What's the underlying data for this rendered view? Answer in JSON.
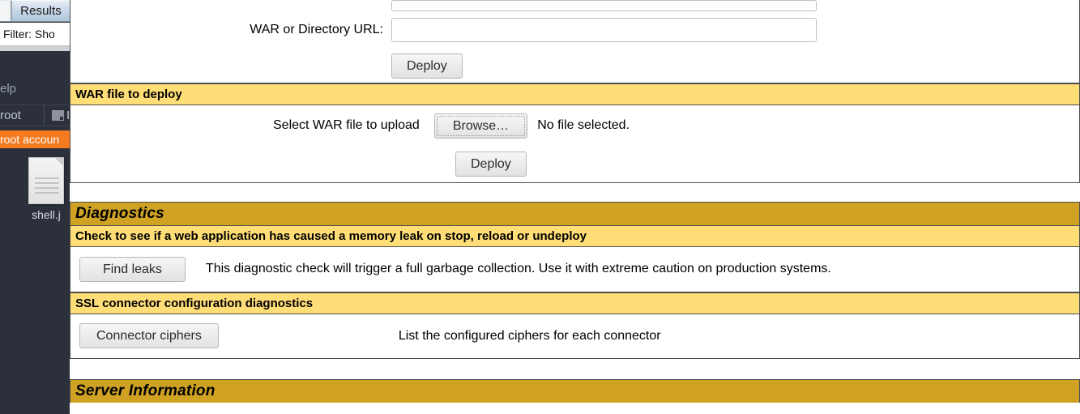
{
  "left_overlay": {
    "tab_label": "Results",
    "filter_text": "Filter: Sho",
    "menu_help": "elp",
    "username": "root",
    "user_trail": "I",
    "monitor_icon": "monitor-icon",
    "warning_banner": "root accoun",
    "desktop_file": {
      "icon": "file-document-icon",
      "name": "shell.j"
    }
  },
  "manager": {
    "deploy_directory": {
      "url_label": "WAR or Directory URL:",
      "url_value": "",
      "deploy_button": "Deploy"
    },
    "war_upload": {
      "header": "WAR file to deploy",
      "select_label": "Select WAR file to upload",
      "browse_button": "Browse…",
      "no_file_text": "No file selected.",
      "deploy_button": "Deploy"
    },
    "diagnostics": {
      "header": "Diagnostics",
      "memory_leak": {
        "header": "Check to see if a web application has caused a memory leak on stop, reload or undeploy",
        "button": "Find leaks",
        "description": "This diagnostic check will trigger a full garbage collection. Use it with extreme caution on production systems."
      },
      "ssl": {
        "header": "SSL connector configuration diagnostics",
        "button": "Connector ciphers",
        "description": "List the configured ciphers for each connector"
      }
    },
    "server_information": {
      "header": "Server Information"
    }
  },
  "colors": {
    "header_major": "#cfa223",
    "header_minor": "#ffdd77",
    "warning_orange": "#f47b20",
    "panel_border": "#4d4d4d",
    "desktop_dark": "#2b303b"
  }
}
